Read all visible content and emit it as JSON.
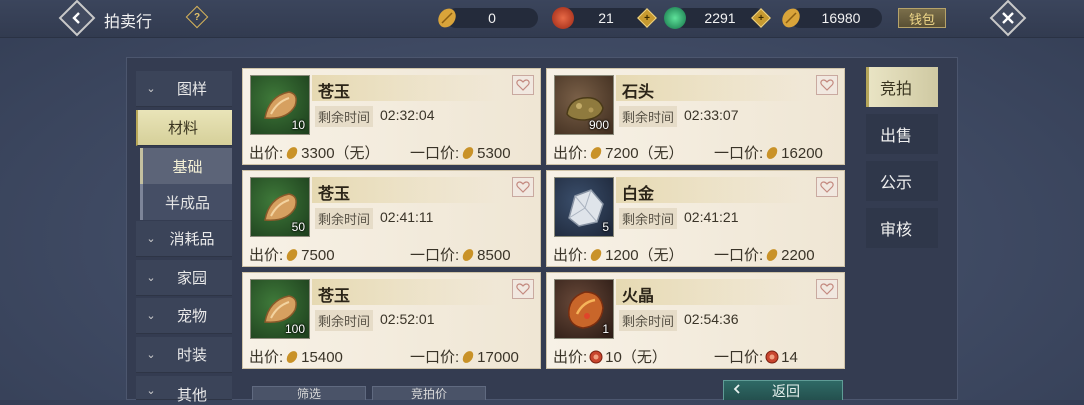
{
  "header": {
    "title": "拍卖行",
    "help_icon": "?",
    "back_icon": "chevron-left-icon",
    "close_icon": "close-icon",
    "currencies": [
      {
        "icon": "gold-leaf-icon",
        "value": "0",
        "color": "#d9a43a"
      },
      {
        "icon": "red-orb-icon",
        "value": "21",
        "color": "#c8452e"
      },
      {
        "icon": "jade-icon",
        "value": "2291",
        "color": "#2fae6a"
      },
      {
        "icon": "gold-leaf-icon",
        "value": "16980",
        "color": "#d9a43a"
      }
    ],
    "plus_label": "+",
    "wallet_label": "钱包"
  },
  "categories": [
    {
      "label": "图样",
      "chevron": "⌄"
    },
    {
      "label": "材料",
      "chevron": ""
    },
    {
      "label": "消耗品",
      "chevron": "⌄"
    },
    {
      "label": "家园",
      "chevron": "⌄"
    },
    {
      "label": "宠物",
      "chevron": "⌄"
    },
    {
      "label": "时装",
      "chevron": "⌄"
    },
    {
      "label": "其他",
      "chevron": "⌄"
    }
  ],
  "subcategories": [
    {
      "label": "基础"
    },
    {
      "label": "半成品"
    }
  ],
  "items": [
    {
      "name": "苍玉",
      "qty": "10",
      "time_label": "剩余时间",
      "time": "02:32:04",
      "price_label": "出价:",
      "price": "3300（无）",
      "buyout_label": "一口价:",
      "buyout": "5300"
    },
    {
      "name": "石头",
      "qty": "900",
      "time_label": "剩余时间",
      "time": "02:33:07",
      "price_label": "出价:",
      "price": "7200（无）",
      "buyout_label": "一口价:",
      "buyout": "16200"
    },
    {
      "name": "苍玉",
      "qty": "50",
      "time_label": "剩余时间",
      "time": "02:41:11",
      "price_label": "出价:",
      "price": "7500",
      "buyout_label": "一口价:",
      "buyout": "8500"
    },
    {
      "name": "白金",
      "qty": "5",
      "time_label": "剩余时间",
      "time": "02:41:21",
      "price_label": "出价:",
      "price": "1200（无）",
      "buyout_label": "一口价:",
      "buyout": "2200"
    },
    {
      "name": "苍玉",
      "qty": "100",
      "time_label": "剩余时间",
      "time": "02:52:01",
      "price_label": "出价:",
      "price": "15400",
      "buyout_label": "一口价:",
      "buyout": "17000"
    },
    {
      "name": "火晶",
      "qty": "1",
      "time_label": "剩余时间",
      "time": "02:54:36",
      "price_label": "出价:",
      "price": "10（无）",
      "buyout_label": "一口价:",
      "buyout": "14"
    }
  ],
  "right_tabs": [
    {
      "label": "竞拍"
    },
    {
      "label": "出售"
    },
    {
      "label": "公示"
    },
    {
      "label": "审核"
    }
  ],
  "bottom": {
    "filter_label": "筛选",
    "sort_label": "竞拍价",
    "return_label": "返回"
  }
}
